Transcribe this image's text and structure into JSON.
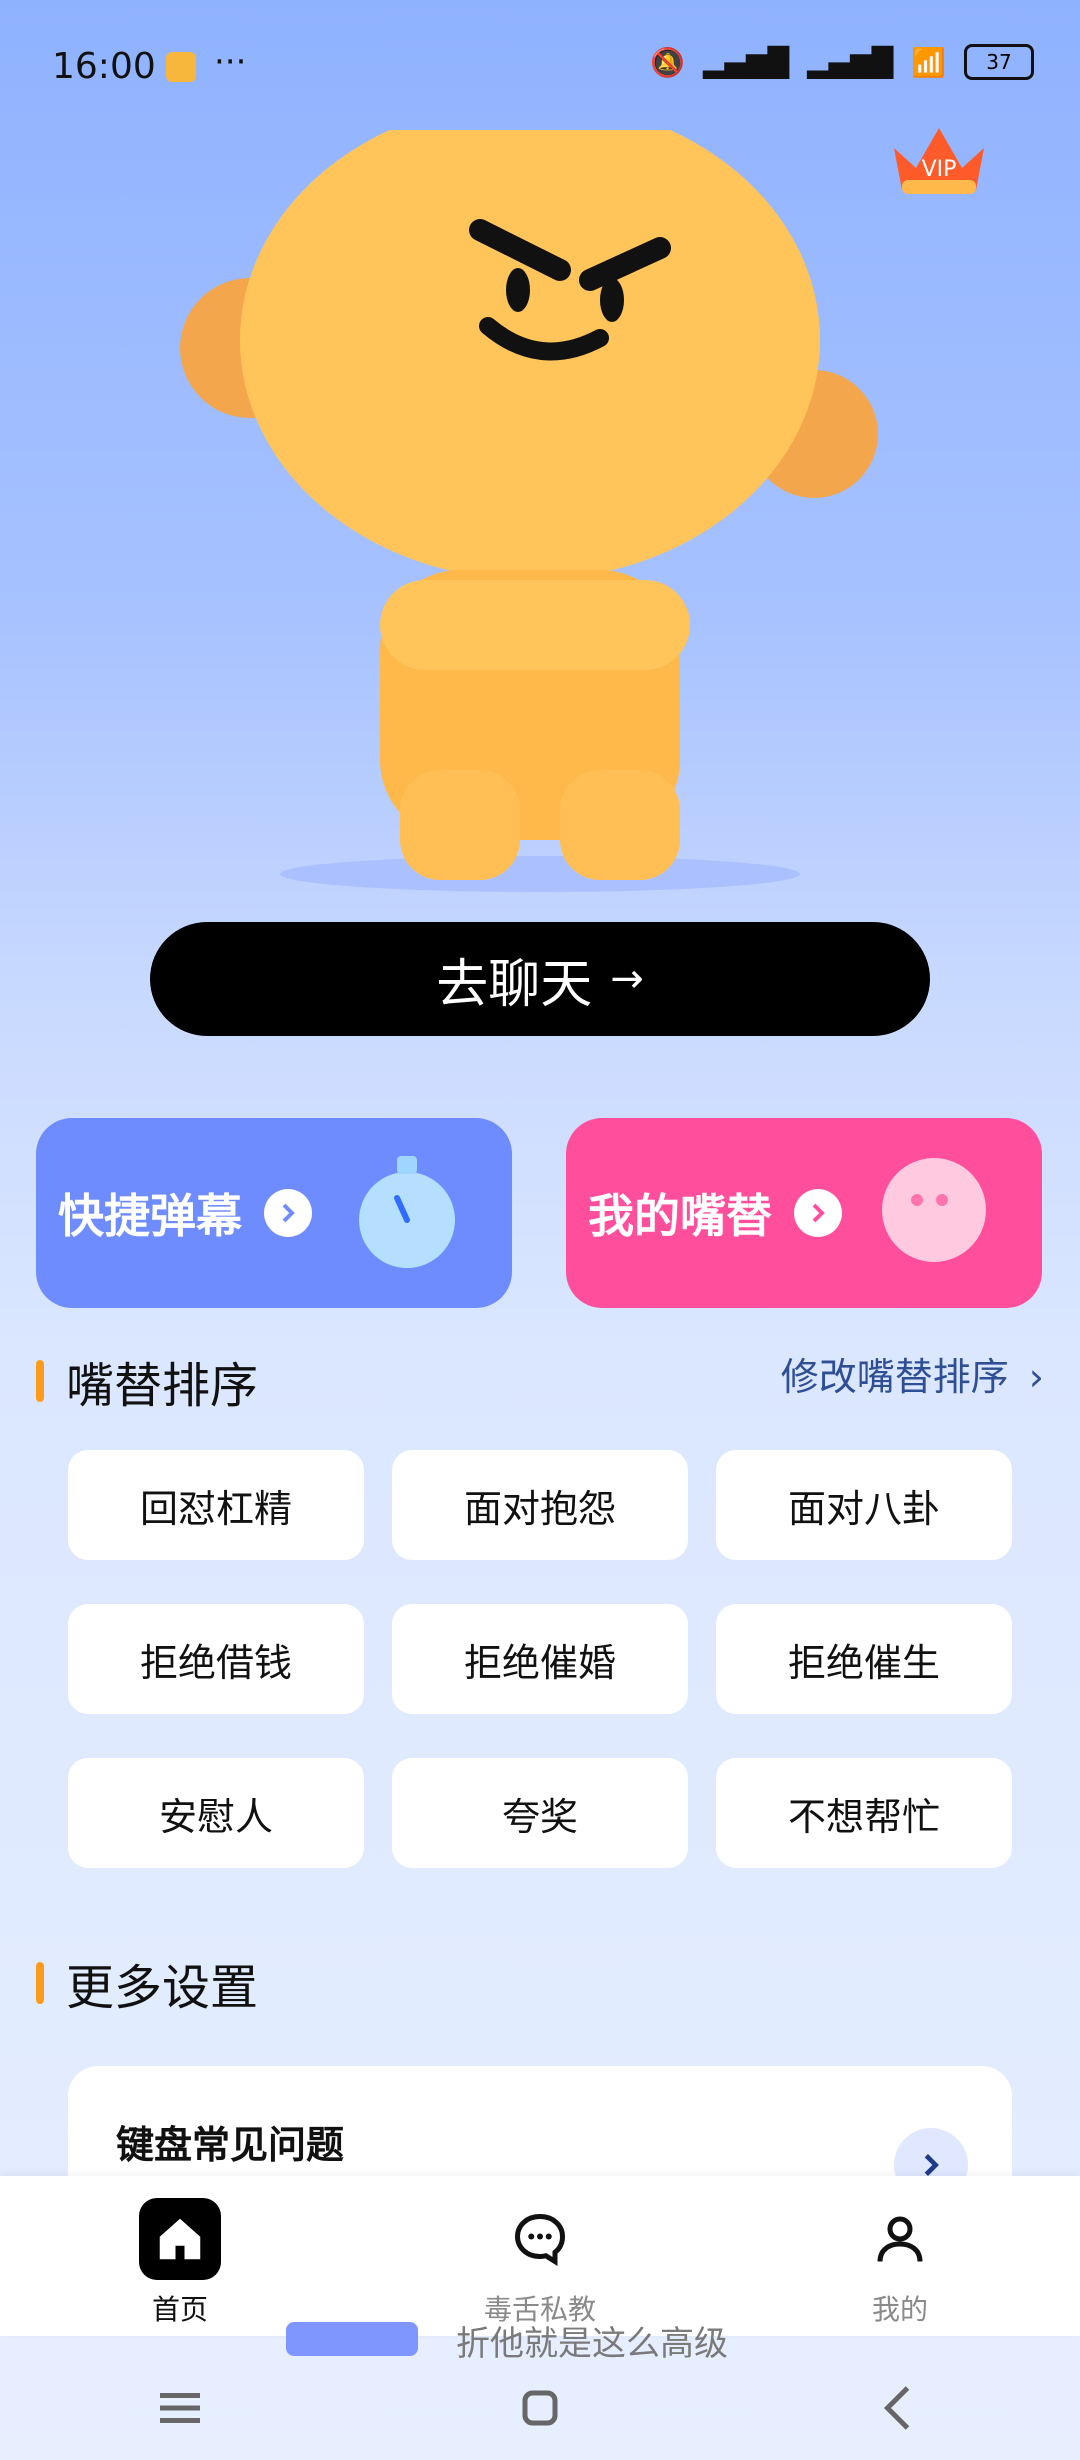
{
  "status_bar": {
    "time": "16:00",
    "dots": "···",
    "battery": "37"
  },
  "vip_badge": "VIP",
  "hero": {
    "chat_button_label": "去聊天"
  },
  "feature_cards": [
    {
      "label": "快捷弹幕"
    },
    {
      "label": "我的嘴替"
    }
  ],
  "section_sort": {
    "title": "嘴替排序",
    "edit_link": "修改嘴替排序"
  },
  "chips": [
    "回怼杠精",
    "面对抱怨",
    "面对八卦",
    "拒绝借钱",
    "拒绝催婚",
    "拒绝催生",
    "安慰人",
    "夸奖",
    "不想帮忙"
  ],
  "section_more": {
    "title": "更多设置"
  },
  "more_card": {
    "title": "键盘常见问题"
  },
  "bottom_nav": [
    {
      "label": "首页",
      "active": true
    },
    {
      "label": "毒舌私教",
      "active": false
    },
    {
      "label": "我的",
      "active": false
    }
  ],
  "peek_text": "折他就是这么高级"
}
